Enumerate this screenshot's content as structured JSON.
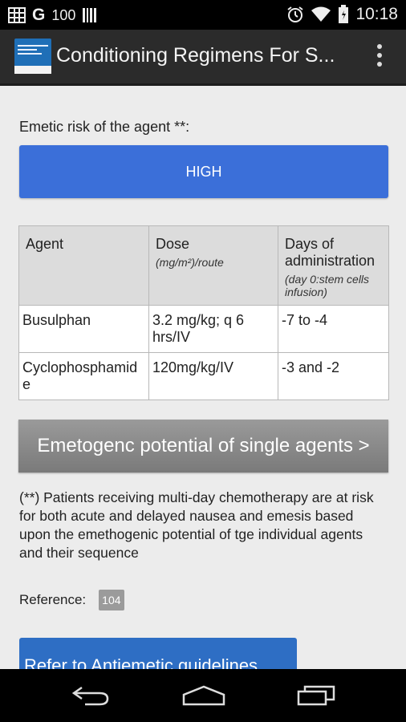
{
  "status_bar": {
    "left_icons": [
      "grid-icon",
      "g-icon",
      "battery-100-text",
      "barcode-icon"
    ],
    "battery_text": "100",
    "g_letter": "G",
    "time": "10:18",
    "right_icons": [
      "alarm-icon",
      "wifi-icon",
      "battery-icon"
    ]
  },
  "action_bar": {
    "title": "Conditioning Regimens For S..."
  },
  "main": {
    "emetic_label": "Emetic risk of the agent **:",
    "risk_value": "HIGH",
    "accent_color": "#3b6fd9",
    "table": {
      "headers": [
        {
          "title": "Agent",
          "sub": ""
        },
        {
          "title": "Dose",
          "sub": "(mg/m²)/route"
        },
        {
          "title": "Days of administration",
          "sub": "(day 0:stem cells infusion)"
        }
      ],
      "rows": [
        {
          "agent": "Busulphan",
          "dose": "3.2 mg/kg; q 6 hrs/IV",
          "days": "-7 to -4"
        },
        {
          "agent": "Cyclophosphamide",
          "dose": "120mg/kg/IV",
          "days": "-3 and -2"
        }
      ]
    },
    "single_agents_button": "Emetogenc potential of single agents >",
    "note": "(**) Patients receiving multi-day chemotherapy are at risk for both acute and delayed nausea and emesis based upon the emethogenic potential of tge individual agents and their sequence",
    "reference_label": "Reference:",
    "reference_number": "104",
    "guidelines_button": "Refer to Antiemetic guidelines"
  },
  "nav_bar": {
    "icons": [
      "back-icon",
      "home-icon",
      "recents-icon"
    ]
  }
}
